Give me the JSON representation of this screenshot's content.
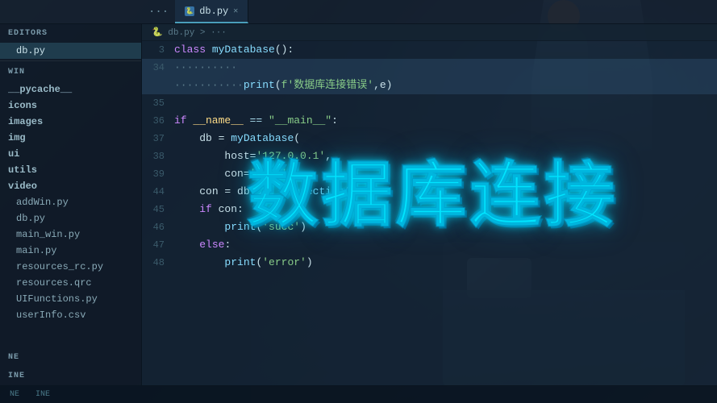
{
  "app": {
    "title": "VS Code - db.py"
  },
  "tabs": [
    {
      "id": "ellipsis",
      "label": "...",
      "active": false,
      "is_ellipsis": true
    },
    {
      "id": "db_py",
      "label": "db.py",
      "active": true,
      "icon": "python",
      "closable": true
    }
  ],
  "breadcrumb": "db.py > ...",
  "sidebar": {
    "sections": [
      {
        "id": "editors",
        "header": "EDITORS",
        "items": [
          {
            "id": "db_py_editor",
            "label": "db.py",
            "active": true,
            "indent": 1
          }
        ]
      },
      {
        "id": "win",
        "header": "WIN",
        "items": [
          {
            "id": "pycache",
            "label": "__pycache__",
            "indent": 1,
            "folder": true
          },
          {
            "id": "icons",
            "label": "icons",
            "indent": 1,
            "folder": true
          },
          {
            "id": "images",
            "label": "images",
            "indent": 1,
            "folder": true
          },
          {
            "id": "img",
            "label": "img",
            "indent": 1,
            "folder": true
          },
          {
            "id": "ui",
            "label": "ui",
            "indent": 1,
            "folder": true
          },
          {
            "id": "utils",
            "label": "utils",
            "indent": 1,
            "folder": true
          },
          {
            "id": "video",
            "label": "video",
            "indent": 1,
            "folder": true
          },
          {
            "id": "addWin_py",
            "label": "addWin.py",
            "indent": 1
          },
          {
            "id": "db_py_file",
            "label": "db.py",
            "indent": 1
          },
          {
            "id": "main_win_py",
            "label": "main_win.py",
            "indent": 1
          },
          {
            "id": "main_py",
            "label": "main.py",
            "indent": 1
          },
          {
            "id": "resources_rc_py",
            "label": "resources_rc.py",
            "indent": 1
          },
          {
            "id": "resources_qrc",
            "label": "resources.qrc",
            "indent": 1
          },
          {
            "id": "UIFunctions_py",
            "label": "UIFunctions.py",
            "indent": 1
          },
          {
            "id": "userInfo_csv",
            "label": "userInfo.csv",
            "indent": 1
          }
        ]
      }
    ],
    "bottom_items": [
      {
        "id": "line1",
        "label": "NE"
      },
      {
        "id": "line2",
        "label": "INE"
      }
    ]
  },
  "code": {
    "lines": [
      {
        "num": 3,
        "tokens": [
          {
            "t": "kw",
            "v": "class "
          },
          {
            "t": "fn",
            "v": "myDatabase"
          },
          {
            "t": "pn",
            "v": "():"
          }
        ],
        "highlight": false
      },
      {
        "num": 34,
        "tokens": [
          {
            "t": "cm",
            "v": "·········"
          }
        ],
        "highlight": true
      },
      {
        "num": "",
        "tokens": [
          {
            "t": "cm",
            "v": "···········"
          },
          {
            "t": "fn",
            "v": "print"
          },
          {
            "t": "pn",
            "v": "("
          },
          {
            "t": "fn",
            "v": "f'"
          },
          {
            "t": "str",
            "v": "数据库连接错误"
          },
          {
            "t": "pn",
            "v": "',e)"
          }
        ],
        "highlight": true
      },
      {
        "num": 35,
        "tokens": [],
        "highlight": false
      },
      {
        "num": 36,
        "tokens": [
          {
            "t": "kw",
            "v": "if "
          },
          {
            "t": "cn",
            "v": "__name__"
          },
          {
            "t": "op",
            "v": " == "
          },
          {
            "t": "str",
            "v": "\"__main__\""
          },
          {
            "t": "pn",
            "v": ":"
          }
        ],
        "highlight": false
      },
      {
        "num": 37,
        "tokens": [
          {
            "t": "cm",
            "v": "····"
          },
          {
            "t": "pn",
            "v": "db = "
          },
          {
            "t": "fn",
            "v": "myDatabase"
          },
          {
            "t": "pn",
            "v": "("
          }
        ],
        "highlight": false
      },
      {
        "num": 38,
        "tokens": [
          {
            "t": "cm",
            "v": "········"
          },
          {
            "t": "pn",
            "v": "host="
          },
          {
            "t": "str",
            "v": "'127.0.0.1'"
          },
          {
            "t": "pn",
            "v": ","
          }
        ],
        "highlight": false
      },
      {
        "num": 39,
        "tokens": [
          {
            "t": "cm",
            "v": "········"
          },
          {
            "t": "pn",
            "v": "con="
          },
          {
            "t": "str",
            "v": "'root'"
          }
        ],
        "highlight": false
      },
      {
        "num": 44,
        "tokens": [
          {
            "t": "cm",
            "v": "····"
          },
          {
            "t": "pn",
            "v": "con = db."
          },
          {
            "t": "fn",
            "v": "get_connection"
          },
          {
            "t": "pn",
            "v": "()"
          }
        ],
        "highlight": false
      },
      {
        "num": 45,
        "tokens": [
          {
            "t": "cm",
            "v": "····"
          },
          {
            "t": "kw",
            "v": "if "
          },
          {
            "t": "pn",
            "v": "con:"
          }
        ],
        "highlight": false
      },
      {
        "num": 46,
        "tokens": [
          {
            "t": "cm",
            "v": "········"
          },
          {
            "t": "fn",
            "v": "print"
          },
          {
            "t": "pn",
            "v": "("
          },
          {
            "t": "str",
            "v": "'succ'"
          },
          {
            "t": "pn",
            "v": ")"
          }
        ],
        "highlight": false
      },
      {
        "num": 47,
        "tokens": [
          {
            "t": "cm",
            "v": "····"
          },
          {
            "t": "kw",
            "v": "else"
          },
          {
            "t": "pn",
            "v": ":"
          }
        ],
        "highlight": false
      },
      {
        "num": 48,
        "tokens": [
          {
            "t": "cm",
            "v": "········"
          },
          {
            "t": "fn",
            "v": "print"
          },
          {
            "t": "pn",
            "v": "("
          },
          {
            "t": "str",
            "v": "'error'"
          },
          {
            "t": "pn",
            "v": ")"
          }
        ],
        "highlight": false
      }
    ]
  },
  "overlay": {
    "title": "数据库连接",
    "color": "#00e5ff"
  },
  "status_bar": {
    "items": [
      "NE",
      "INE"
    ]
  }
}
